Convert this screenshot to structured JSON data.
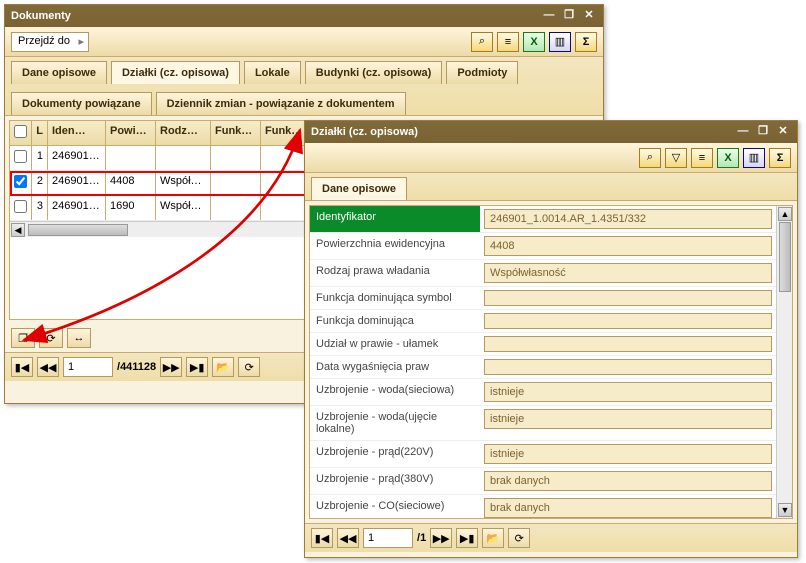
{
  "window1": {
    "title": "Dokumenty",
    "goto": "Przejdź do",
    "tabs_row1": [
      "Dane opisowe",
      "Działki (cz. opisowa)",
      "Lokale",
      "Budynki (cz. opisowa)",
      "Podmioty"
    ],
    "tabs_row2": [
      "Dokumenty powiązane",
      "Dziennik zmian - powiązanie z dokumentem"
    ],
    "active_tab": "Działki (cz. opisowa)",
    "columns": [
      "",
      "L",
      "Iden…",
      "Powi…",
      "Rodz…",
      "Funk…",
      "Funk…"
    ],
    "rows": [
      {
        "checked": false,
        "n": "1",
        "id": "246901…",
        "pow": "",
        "rodz": "",
        "f1": "",
        "f2": ""
      },
      {
        "checked": true,
        "n": "2",
        "id": "246901…",
        "pow": "4408",
        "rodz": "Współ…",
        "f1": "",
        "f2": ""
      },
      {
        "checked": false,
        "n": "3",
        "id": "246901…",
        "pow": "1690",
        "rodz": "Współ…",
        "f1": "",
        "f2": ""
      }
    ],
    "pager": {
      "page": "1",
      "total": "441128"
    }
  },
  "window2": {
    "title": "Działki (cz. opisowa)",
    "tab": "Dane opisowe",
    "fields": [
      {
        "label": "Identyfikator",
        "value": "246901_1.0014.AR_1.4351/332",
        "hl": true
      },
      {
        "label": "Powierzchnia ewidencyjna",
        "value": "4408"
      },
      {
        "label": "Rodzaj prawa władania",
        "value": "Współwłasność"
      },
      {
        "label": "Funkcja dominująca symbol",
        "value": ""
      },
      {
        "label": "Funkcja dominująca",
        "value": ""
      },
      {
        "label": "Udział w prawie - ułamek",
        "value": ""
      },
      {
        "label": "Data wygaśnięcia praw",
        "value": ""
      },
      {
        "label": "Uzbrojenie - woda(sieciowa)",
        "value": "istnieje"
      },
      {
        "label": "Uzbrojenie - woda(ujęcie lokalne)",
        "value": "istnieje"
      },
      {
        "label": "Uzbrojenie - prąd(220V)",
        "value": "istnieje"
      },
      {
        "label": "Uzbrojenie - prąd(380V)",
        "value": "brak danych"
      },
      {
        "label": "Uzbrojenie - CO(sieciowe)",
        "value": "brak danych"
      }
    ],
    "pager": {
      "page": "1",
      "total": "1"
    }
  },
  "icons": {
    "search": "⌕",
    "filter": "▽",
    "barcode": "≡",
    "excel": "X",
    "cols": "▥",
    "sigma": "Σ",
    "popup": "❐",
    "refresh": "⟳",
    "hsize": "↔",
    "first": "▮◀",
    "prev": "◀◀",
    "next": "▶▶",
    "last": "▶▮",
    "folder": "📂",
    "reload": "⟳",
    "slash": "/",
    "min": "—",
    "max": "❐",
    "close": "✕"
  }
}
